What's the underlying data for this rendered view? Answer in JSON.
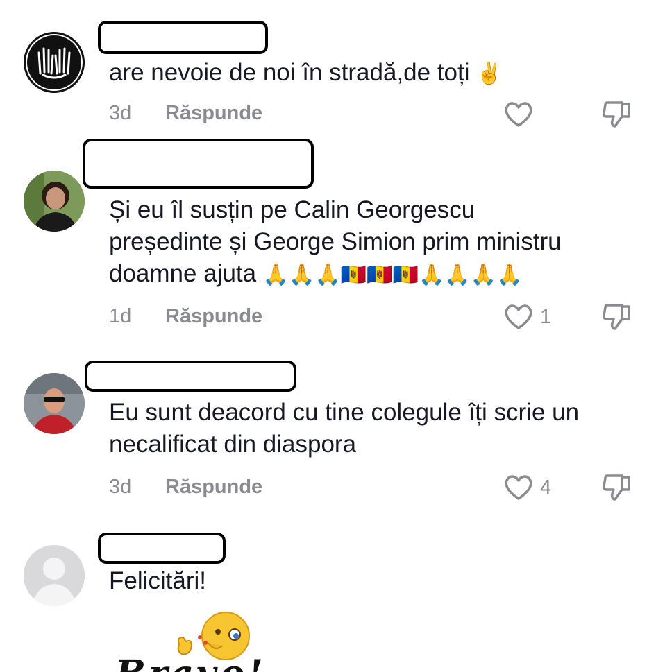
{
  "comments": [
    {
      "text": "are nevoie de noi în stradă,de toți",
      "emoji": "✌️",
      "age": "3d",
      "reply_label": "Răspunde",
      "likes": ""
    },
    {
      "text_line1": "Și eu îl susțin pe Calin Georgescu",
      "text_line2": "președinte și George Simion prim ministru",
      "text_line3": "doamne ajuta",
      "emoji": "🙏🙏🙏🇲🇩🇲🇩🇲🇩🙏🙏🙏🙏",
      "age": "1d",
      "reply_label": "Răspunde",
      "likes": "1"
    },
    {
      "text_line1": "Eu sunt deacord cu tine colegule îți scrie un",
      "text_line2": "necalificat din diaspora",
      "age": "3d",
      "reply_label": "Răspunde",
      "likes": "4"
    },
    {
      "text": "Felicitări!",
      "sticker_text": "Bravo!"
    }
  ],
  "icons": {
    "like": "heart-outline-icon",
    "dislike": "thumbs-down-outline-icon",
    "default_avatar": "person-placeholder-icon"
  },
  "colors": {
    "text": "#161823",
    "meta": "#8a8b91"
  }
}
